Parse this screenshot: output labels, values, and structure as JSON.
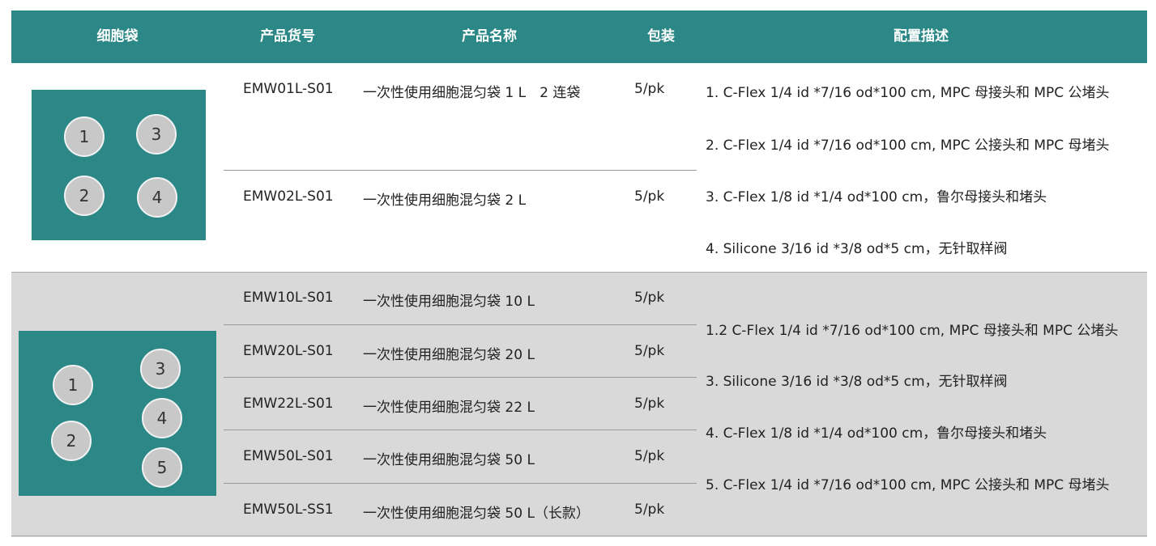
{
  "header": {
    "bag": "细胞袋",
    "code": "产品货号",
    "name": "产品名称",
    "pack": "包装",
    "config": "配置描述"
  },
  "section1": {
    "ports": [
      "1",
      "3",
      "2",
      "4"
    ],
    "rows": [
      {
        "code": "EMW01L-S01",
        "name": "一次性使用细胞混匀袋 1 L　2 连袋",
        "pack": "5/pk"
      },
      {
        "code": "EMW02L-S01",
        "name": "一次性使用细胞混匀袋 2 L",
        "pack": "5/pk"
      }
    ],
    "config": [
      "1. C-Flex 1/4 id *7/16 od*100 cm, MPC 母接头和 MPC 公堵头",
      "2. C-Flex 1/4 id *7/16 od*100 cm, MPC 公接头和 MPC 母堵头",
      "3. C-Flex 1/8 id *1/4 od*100 cm，鲁尔母接头和堵头",
      "4. Silicone 3/16 id *3/8 od*5 cm，无针取样阀"
    ]
  },
  "section2": {
    "ports": [
      "1",
      "2",
      "3",
      "4",
      "5"
    ],
    "rows": [
      {
        "code": "EMW10L-S01",
        "name": "一次性使用细胞混匀袋 10 L",
        "pack": "5/pk"
      },
      {
        "code": "EMW20L-S01",
        "name": "一次性使用细胞混匀袋 20 L",
        "pack": "5/pk"
      },
      {
        "code": "EMW22L-S01",
        "name": "一次性使用细胞混匀袋 22 L",
        "pack": "5/pk"
      },
      {
        "code": "EMW50L-S01",
        "name": "一次性使用细胞混匀袋 50 L",
        "pack": "5/pk"
      },
      {
        "code": "EMW50L-SS1",
        "name": "一次性使用细胞混匀袋 50 L（长款）",
        "pack": "5/pk"
      }
    ],
    "config": [
      "1.2 C-Flex 1/4 id *7/16 od*100 cm, MPC 母接头和 MPC 公堵头",
      "3. Silicone 3/16 id *3/8 od*5 cm，无针取样阀",
      "4. C-Flex 1/8 id *1/4 od*100 cm，鲁尔母接头和堵头",
      "5. C-Flex 1/4 id *7/16 od*100 cm, MPC 公接头和 MPC 母堵头"
    ]
  },
  "colors": {
    "header_bg": "#2b8886",
    "bag_color": "#2b8886",
    "port_color": "#c8c8c8",
    "section2_bg": "#d9d9d9"
  }
}
